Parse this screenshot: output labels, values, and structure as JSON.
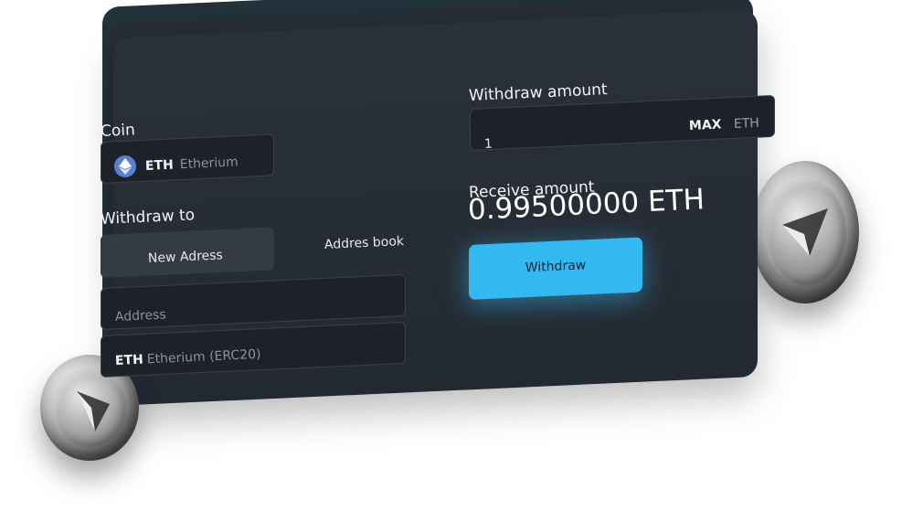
{
  "coin_section": {
    "label": "Coin",
    "symbol": "ETH",
    "name": "Etherium"
  },
  "withdraw_to": {
    "label": "Withdraw to",
    "tabs": [
      "New Adress",
      "Addres book"
    ],
    "address_placeholder": "Address",
    "network_symbol": "ETH",
    "network_name": "Etherium (ERC20)"
  },
  "withdraw_amount": {
    "label": "Withdraw amount",
    "value": "1",
    "max_label": "MAX",
    "unit": "ETH"
  },
  "receive": {
    "label": "Receive amount",
    "amount": "0.99500000 ETH"
  },
  "withdraw_button": {
    "label": "Withdraw"
  },
  "colors": {
    "card": "#2a3038",
    "field": "#1d2229",
    "accent": "#33b8f2",
    "text": "#f2f4f7"
  }
}
